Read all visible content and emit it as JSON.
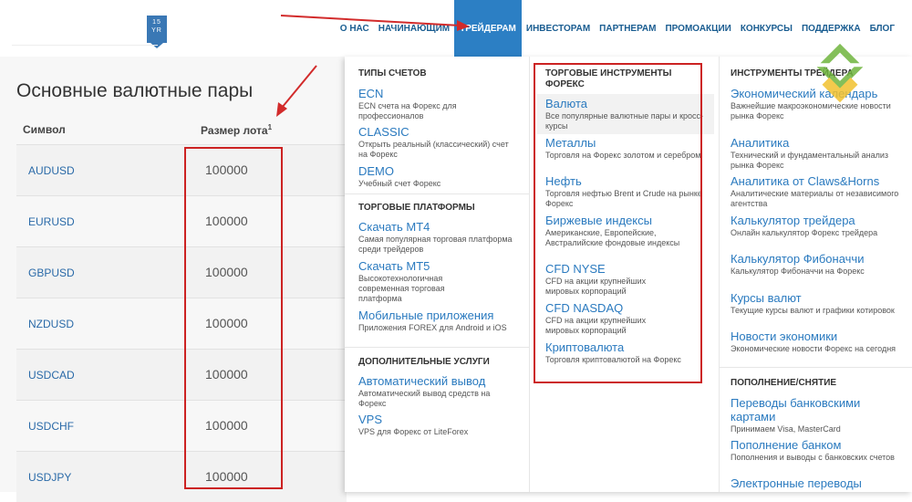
{
  "logo": {
    "line1": "15",
    "line2": "YR"
  },
  "nav": [
    {
      "label": "О НАС"
    },
    {
      "label": "НАЧИНАЮЩИМ"
    },
    {
      "label": "ТРЕЙДЕРАМ"
    },
    {
      "label": "ИНВЕСТОРАМ"
    },
    {
      "label": "ПАРТНЕРАМ"
    },
    {
      "label": "ПРОМОАКЦИИ"
    },
    {
      "label": "КОНКУРСЫ"
    },
    {
      "label": "ПОДДЕРЖКА"
    },
    {
      "label": "БЛОГ"
    }
  ],
  "page_title": "Основные валютные пары",
  "table": {
    "col_symbol": "Символ",
    "col_lot": "Размер лота",
    "col_lot_sup": "1",
    "rows": [
      {
        "symbol": "AUDUSD",
        "lot": "100000"
      },
      {
        "symbol": "EURUSD",
        "lot": "100000"
      },
      {
        "symbol": "GBPUSD",
        "lot": "100000"
      },
      {
        "symbol": "NZDUSD",
        "lot": "100000"
      },
      {
        "symbol": "USDCAD",
        "lot": "100000"
      },
      {
        "symbol": "USDCHF",
        "lot": "100000"
      },
      {
        "symbol": "USDJPY",
        "lot": "100000"
      }
    ]
  },
  "menu": {
    "col1": {
      "sec1": "ТИПЫ СЧЕТОВ",
      "items1": [
        {
          "title": "ECN",
          "desc": "ECN счета на Форекс для профессионалов"
        },
        {
          "title": "CLASSIC",
          "desc": "Открыть реальный (классический) счет на Форекс"
        },
        {
          "title": "DEMO",
          "desc": "Учебный счет Форекс"
        }
      ],
      "sec2": "ТОРГОВЫЕ ПЛАТФОРМЫ",
      "items2": [
        {
          "title": "Скачать MT4",
          "desc": "Самая популярная торговая платформа среди трейдеров"
        },
        {
          "title": "Скачать MT5",
          "desc": "Высокотехнологичная современная торговая платформа"
        },
        {
          "title": "Мобильные приложения",
          "desc": "Приложения FOREX для Android и iOS"
        }
      ],
      "sec3": "ДОПОЛНИТЕЛЬНЫЕ УСЛУГИ",
      "items3": [
        {
          "title": "Автоматический вывод",
          "desc": "Автоматический вывод средств на Форекс"
        },
        {
          "title": "VPS",
          "desc": "VPS для Форекс от LiteForex"
        }
      ]
    },
    "col2": {
      "sec1": "ТОРГОВЫЕ ИНСТРУМЕНТЫ ФОРЕКС",
      "items": [
        {
          "title": "Валюта",
          "desc": "Все популярные валютные пары и кросс-курсы"
        },
        {
          "title": "Металлы",
          "desc": "Торговля на Форекс золотом и серебром"
        },
        {
          "title": "Нефть",
          "desc": "Торговля нефтью Brent и Crude на рынке Форекс"
        },
        {
          "title": "Биржевые индексы",
          "desc": "Американские, Европейские, Австралийские фондовые индексы"
        },
        {
          "title": "CFD NYSE",
          "desc": "CFD на акции крупнейших мировых корпораций"
        },
        {
          "title": "CFD NASDAQ",
          "desc": "CFD на акции крупнейших мировых корпораций"
        },
        {
          "title": "Криптовалюта",
          "desc": "Торговля криптовалютой на Форекс"
        }
      ]
    },
    "col3": {
      "sec1": "ИНСТРУМЕНТЫ ТРЕЙДЕРА",
      "items": [
        {
          "title": "Экономический календарь",
          "desc": "Важнейшие макроэкономические новости рынка Форекс"
        },
        {
          "title": "Аналитика",
          "desc": "Технический и фундаментальный анализ рынка Форекс"
        },
        {
          "title": "Аналитика от Claws&Horns",
          "desc": "Аналитические материалы от независимого агентства"
        },
        {
          "title": "Калькулятор трейдера",
          "desc": "Онлайн калькулятор Форекс трейдера"
        },
        {
          "title": "Калькулятор Фибоначчи",
          "desc": "Калькулятор Фибоначчи на Форекс"
        },
        {
          "title": "Курсы валют",
          "desc": "Текущие курсы валют и графики котировок"
        },
        {
          "title": "Новости экономики",
          "desc": "Экономические новости Форекс на сегодня"
        }
      ],
      "sec2": "ПОПОЛНЕНИЕ/СНЯТИЕ",
      "items2": [
        {
          "title": "Переводы банковскими картами",
          "desc": "Принимаем Visa, MasterCard"
        },
        {
          "title": "Пополнение банком",
          "desc": "Пополнения и выводы с банковских счетов"
        },
        {
          "title": "Электронные переводы",
          "desc": ""
        }
      ]
    }
  },
  "colors": {
    "accent": "#2c7fc4",
    "link": "#2a7abf",
    "highlight_box": "#cc2222",
    "arrow": "#d22b2b"
  }
}
